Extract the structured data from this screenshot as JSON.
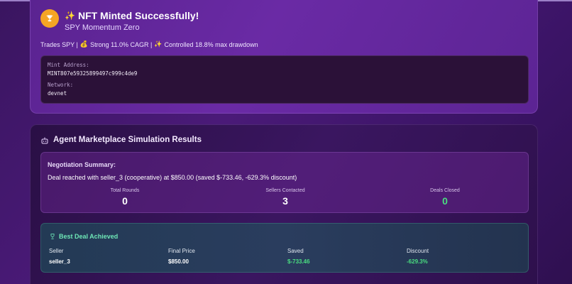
{
  "nft": {
    "title": "NFT Minted Successfully!",
    "subtitle": "SPY Momentum Zero",
    "desc_part1": "Trades SPY |",
    "desc_part2": "Strong 11.0% CAGR |",
    "desc_part3": "Controlled 18.8% max drawdown",
    "mint_label": "Mint Address:",
    "mint_value": "MINT807e59325899497c999c4de9",
    "network_label": "Network:",
    "network_value": "devnet"
  },
  "marketplace": {
    "title": "Agent Marketplace Simulation Results",
    "negotiation": {
      "title": "Negotiation Summary:",
      "text": "Deal reached with seller_3 (cooperative) at $850.00 (saved $-733.46, -629.3% discount)",
      "stats": [
        {
          "label": "Total Rounds",
          "value": "0"
        },
        {
          "label": "Sellers Contacted",
          "value": "3"
        },
        {
          "label": "Deals Closed",
          "value": "0"
        }
      ]
    },
    "best_deal": {
      "title": "Best Deal Achieved",
      "columns": [
        {
          "label": "Seller",
          "value": "seller_3"
        },
        {
          "label": "Final Price",
          "value": "$850.00"
        },
        {
          "label": "Saved",
          "value": "$-733.46"
        },
        {
          "label": "Discount",
          "value": "-629.3%"
        }
      ]
    }
  },
  "colors": {
    "accent_green": "#4ade80",
    "trophy_orange": "#f5a524"
  }
}
